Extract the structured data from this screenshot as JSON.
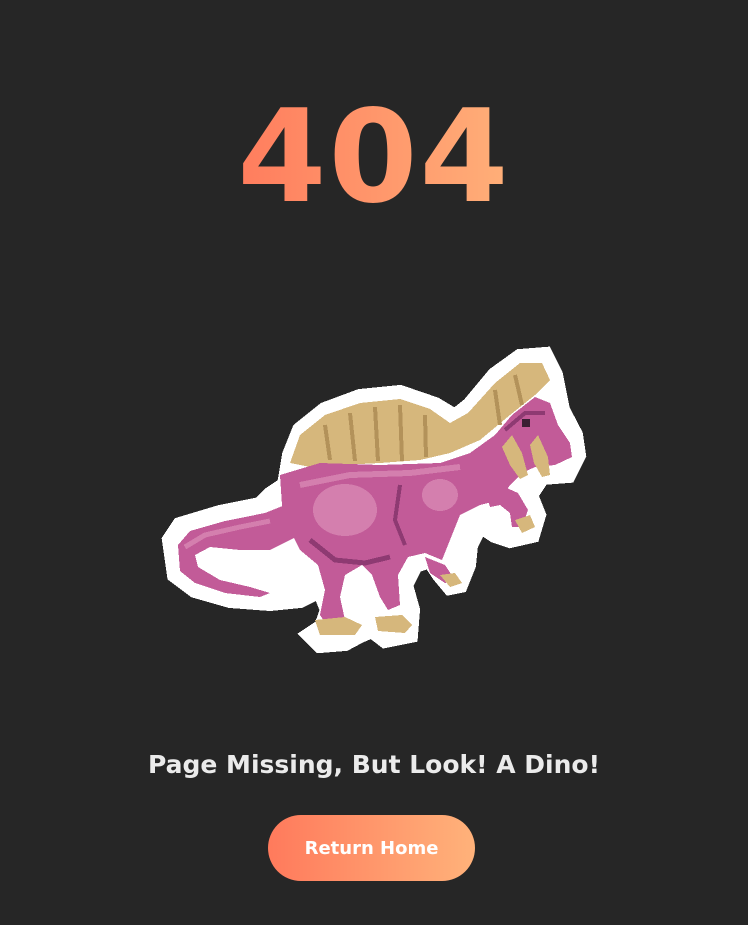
{
  "error": {
    "code": "404"
  },
  "illustration": {
    "icon": "pixel-spinosaurus-dino-icon",
    "colors": {
      "body": "#c25b98",
      "body_light": "#d47fae",
      "body_dark": "#8e3a72",
      "sail": "#d6b77c",
      "sail_dark": "#b3925a",
      "outline": "#ffffff"
    }
  },
  "message": {
    "text": "Page Missing, But Look! A Dino!"
  },
  "actions": {
    "home_label": "Return Home"
  },
  "theme": {
    "background": "#262626",
    "accent_start": "#ff7a5c",
    "accent_end": "#ffb27a",
    "text": "#ebebeb"
  }
}
